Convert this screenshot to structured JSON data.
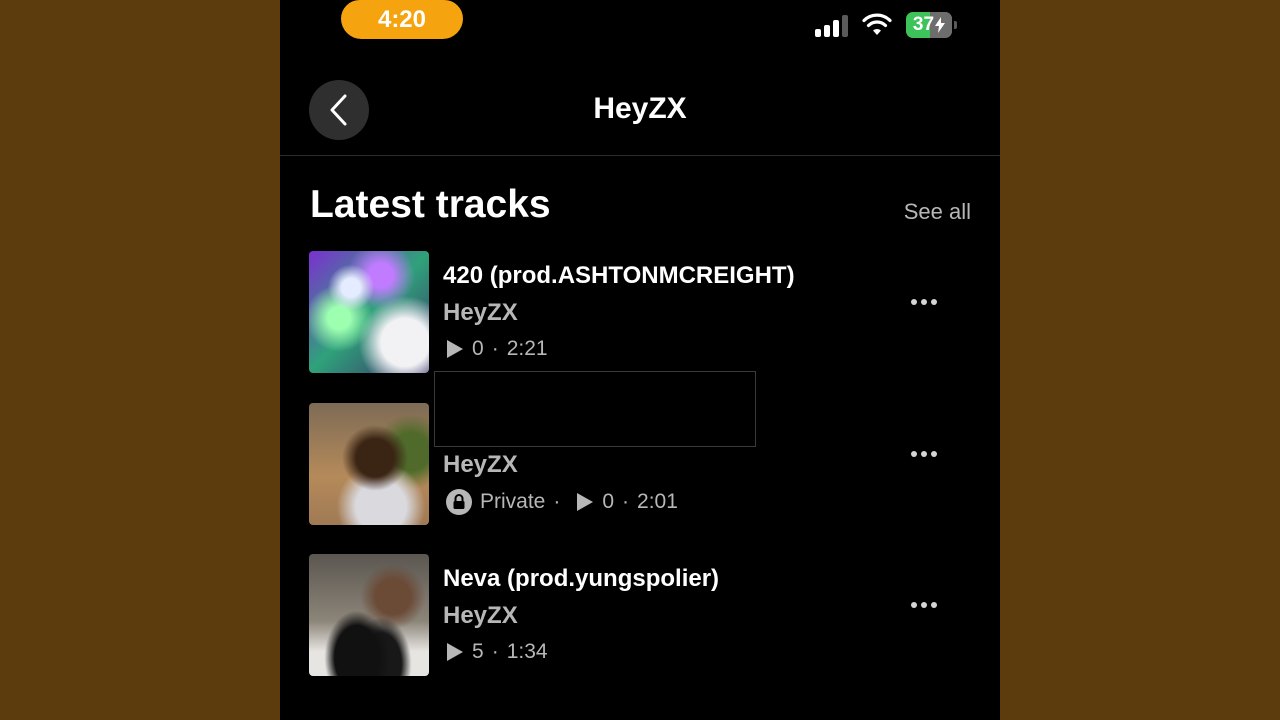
{
  "status_bar": {
    "time": "4:20",
    "battery": "37"
  },
  "header": {
    "title": "HeyZX"
  },
  "section": {
    "title": "Latest tracks",
    "see_all": "See all"
  },
  "tracks": [
    {
      "title": "420 (prod.ASHTONMCREIGHT)",
      "artist": "HeyZX",
      "plays": "0",
      "duration": "2:21"
    },
    {
      "title": "",
      "artist": "HeyZX",
      "visibility": "Private",
      "plays": "0",
      "duration": "2:01"
    },
    {
      "title": "Neva (prod.yungspolier)",
      "artist": "HeyZX",
      "plays": "5",
      "duration": "1:34"
    }
  ],
  "colors": {
    "background": "#5c3b0c",
    "time_pill": "#f5a30f",
    "battery": "#3ec25a"
  }
}
